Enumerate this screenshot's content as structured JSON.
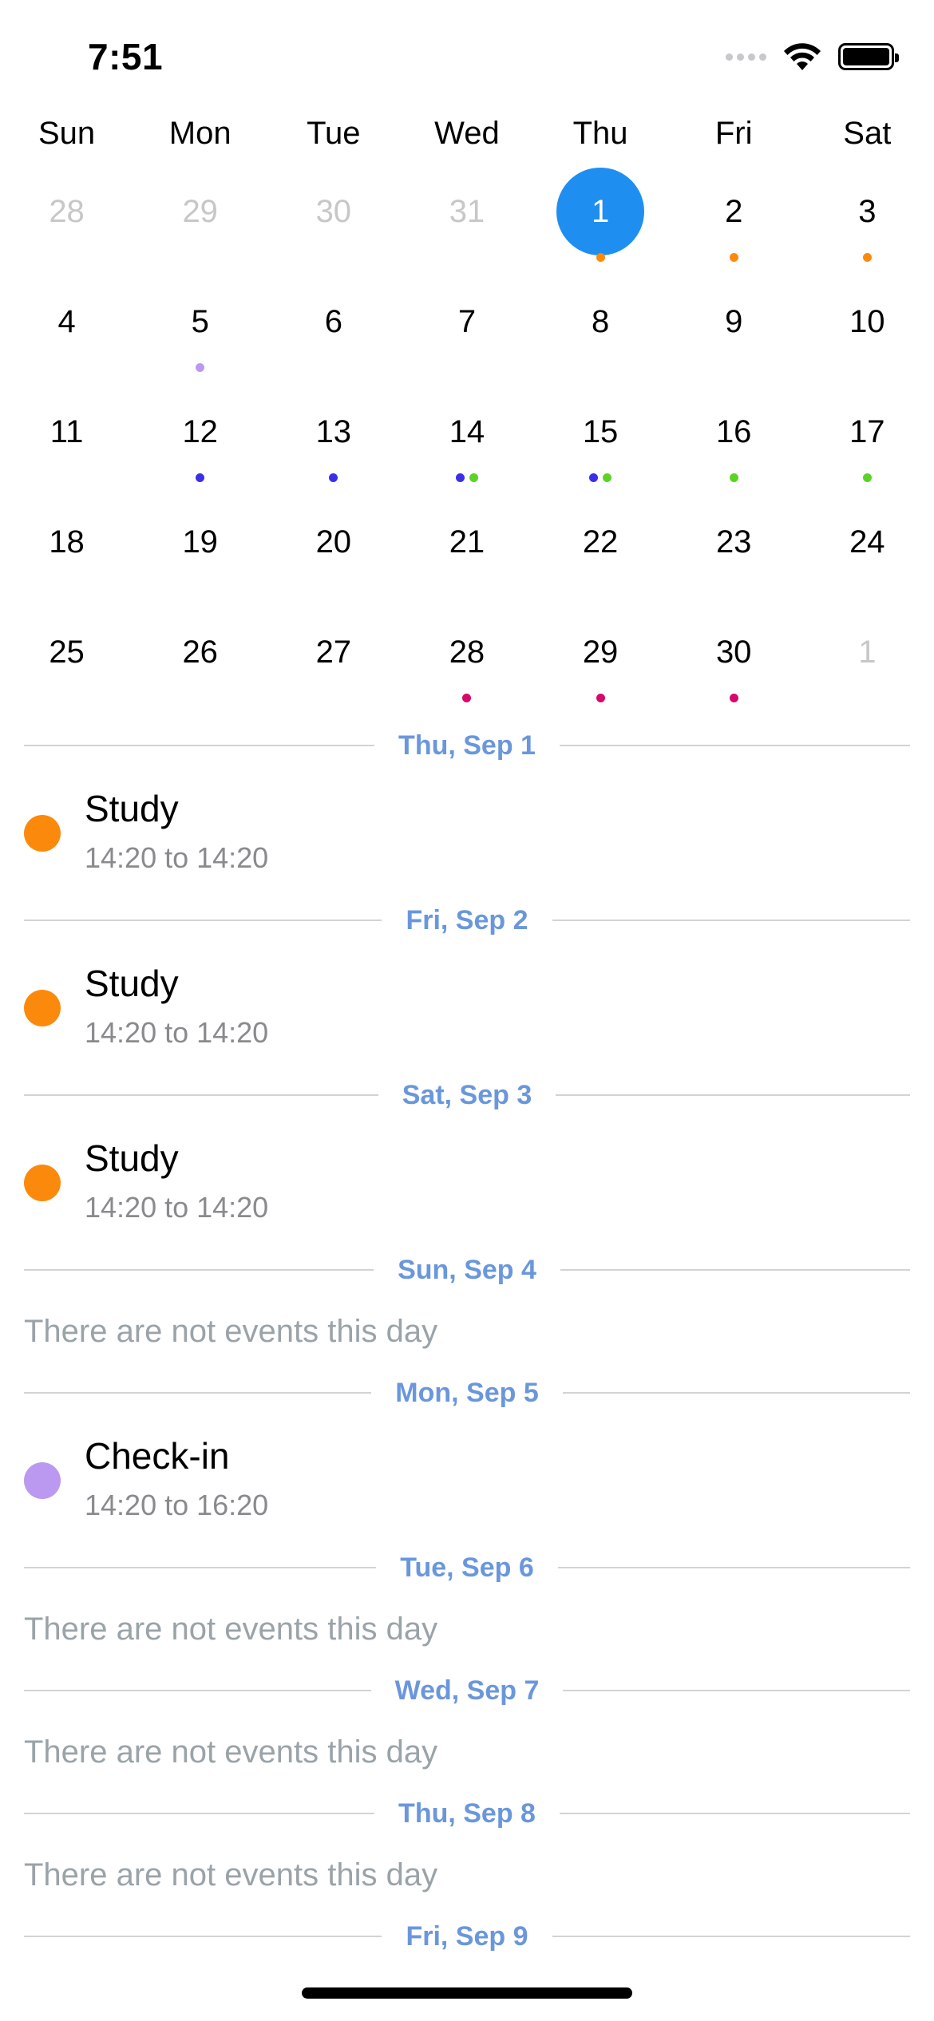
{
  "status_bar": {
    "time": "7:51"
  },
  "colors": {
    "selected": "#1f8ef1",
    "orange": "#fb8a0c",
    "lavender": "#bb99f0",
    "blue": "#3b2fe6",
    "green": "#5bd324",
    "magenta": "#d6096b",
    "section_label": "#6a97dc"
  },
  "calendar": {
    "weekdays": [
      "Sun",
      "Mon",
      "Tue",
      "Wed",
      "Thu",
      "Fri",
      "Sat"
    ],
    "weeks": [
      [
        {
          "day": "28",
          "muted": true,
          "dots": []
        },
        {
          "day": "29",
          "muted": true,
          "dots": []
        },
        {
          "day": "30",
          "muted": true,
          "dots": []
        },
        {
          "day": "31",
          "muted": true,
          "dots": []
        },
        {
          "day": "1",
          "selected": true,
          "dots": [
            "orange"
          ]
        },
        {
          "day": "2",
          "dots": [
            "orange"
          ]
        },
        {
          "day": "3",
          "dots": [
            "orange"
          ]
        }
      ],
      [
        {
          "day": "4",
          "dots": []
        },
        {
          "day": "5",
          "dots": [
            "lavender"
          ]
        },
        {
          "day": "6",
          "dots": []
        },
        {
          "day": "7",
          "dots": []
        },
        {
          "day": "8",
          "dots": []
        },
        {
          "day": "9",
          "dots": []
        },
        {
          "day": "10",
          "dots": []
        }
      ],
      [
        {
          "day": "11",
          "dots": []
        },
        {
          "day": "12",
          "dots": [
            "blue"
          ]
        },
        {
          "day": "13",
          "dots": [
            "blue"
          ]
        },
        {
          "day": "14",
          "dots": [
            "blue",
            "green"
          ]
        },
        {
          "day": "15",
          "dots": [
            "blue",
            "green"
          ]
        },
        {
          "day": "16",
          "dots": [
            "green"
          ]
        },
        {
          "day": "17",
          "dots": [
            "green"
          ]
        }
      ],
      [
        {
          "day": "18",
          "dots": []
        },
        {
          "day": "19",
          "dots": []
        },
        {
          "day": "20",
          "dots": []
        },
        {
          "day": "21",
          "dots": []
        },
        {
          "day": "22",
          "dots": []
        },
        {
          "day": "23",
          "dots": []
        },
        {
          "day": "24",
          "dots": []
        }
      ],
      [
        {
          "day": "25",
          "dots": []
        },
        {
          "day": "26",
          "dots": []
        },
        {
          "day": "27",
          "dots": []
        },
        {
          "day": "28",
          "dots": [
            "magenta"
          ]
        },
        {
          "day": "29",
          "dots": [
            "magenta"
          ]
        },
        {
          "day": "30",
          "dots": [
            "magenta"
          ]
        },
        {
          "day": "1",
          "muted": true,
          "dots": []
        }
      ]
    ]
  },
  "agenda": [
    {
      "header": "Thu, Sep 1",
      "events": [
        {
          "title": "Study",
          "time": "14:20 to 14:20",
          "color": "orange"
        }
      ]
    },
    {
      "header": "Fri, Sep 2",
      "events": [
        {
          "title": "Study",
          "time": "14:20 to 14:20",
          "color": "orange"
        }
      ]
    },
    {
      "header": "Sat, Sep 3",
      "events": [
        {
          "title": "Study",
          "time": "14:20 to 14:20",
          "color": "orange"
        }
      ]
    },
    {
      "header": "Sun, Sep 4",
      "empty": "There are not events this day"
    },
    {
      "header": "Mon, Sep 5",
      "events": [
        {
          "title": "Check-in",
          "time": "14:20 to 16:20",
          "color": "lavender"
        }
      ]
    },
    {
      "header": "Tue, Sep 6",
      "empty": "There are not events this day"
    },
    {
      "header": "Wed, Sep 7",
      "empty": "There are not events this day"
    },
    {
      "header": "Thu, Sep 8",
      "empty": "There are not events this day"
    },
    {
      "header": "Fri, Sep 9"
    }
  ]
}
